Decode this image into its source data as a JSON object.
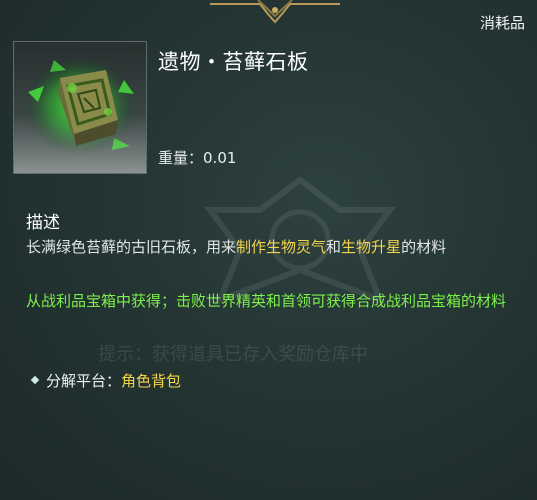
{
  "category_label": "消耗品",
  "item": {
    "name": "遗物・苔藓石板",
    "weight_label": "重量：",
    "weight_value": "0.01"
  },
  "description": {
    "title": "描述",
    "text_prefix": "长满绿色苔藓的古旧石板，用来",
    "highlight_1": "制作生物灵气",
    "text_and": "和",
    "highlight_2": "生物升星",
    "text_suffix": "的材料"
  },
  "source_text": "从战利品宝箱中获得；击败世界精英和首领可获得合成战利品宝箱的材料",
  "background_hint": "提示：获得道具已存入奖励仓库中",
  "salvage": {
    "label": "分解平台：",
    "value": "角色背包"
  },
  "colors": {
    "highlight": "#f3d44b",
    "source_green": "#7ef04a",
    "glow_green": "#4cff3a"
  }
}
